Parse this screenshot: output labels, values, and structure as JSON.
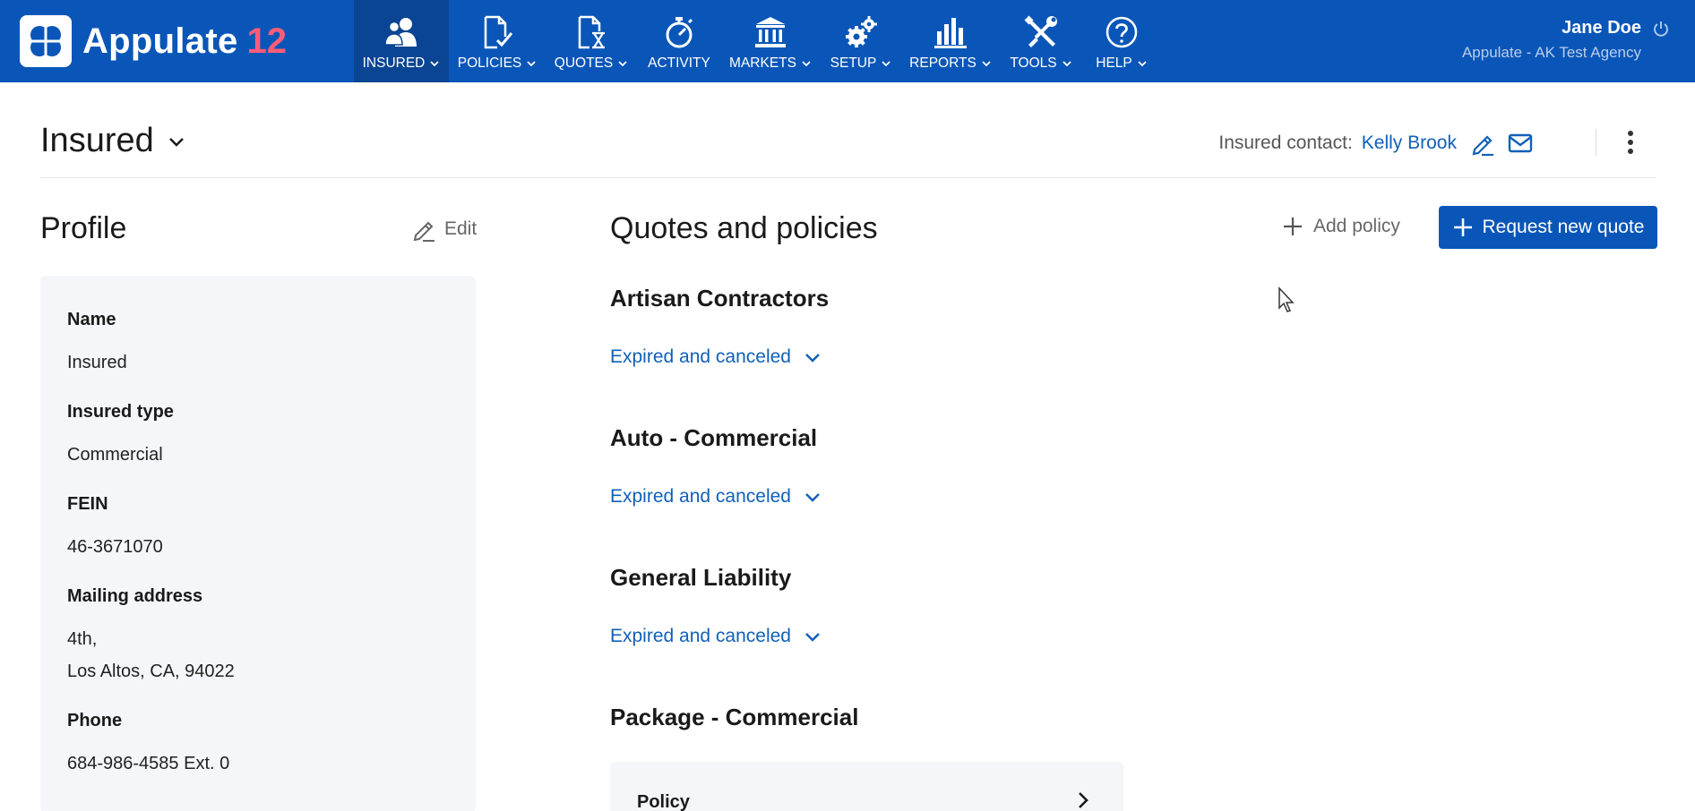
{
  "app": {
    "name": "Appulate",
    "version": "12"
  },
  "nav": {
    "items": [
      {
        "label": "INSURED",
        "icon": "insured-users-icon",
        "has_dropdown": true,
        "active": true
      },
      {
        "label": "POLICIES",
        "icon": "policies-document-check-icon",
        "has_dropdown": true,
        "active": false
      },
      {
        "label": "QUOTES",
        "icon": "quotes-hourglass-document-icon",
        "has_dropdown": true,
        "active": false
      },
      {
        "label": "ACTIVITY",
        "icon": "activity-stopwatch-icon",
        "has_dropdown": false,
        "active": false
      },
      {
        "label": "MARKETS",
        "icon": "markets-bank-icon",
        "has_dropdown": true,
        "active": false
      },
      {
        "label": "SETUP",
        "icon": "setup-gears-icon",
        "has_dropdown": true,
        "active": false
      },
      {
        "label": "REPORTS",
        "icon": "reports-bar-chart-icon",
        "has_dropdown": true,
        "active": false
      },
      {
        "label": "TOOLS",
        "icon": "tools-wrench-screwdriver-icon",
        "has_dropdown": true,
        "active": false
      },
      {
        "label": "HELP",
        "icon": "help-question-icon",
        "has_dropdown": true,
        "active": false
      }
    ]
  },
  "user": {
    "name": "Jane Doe",
    "organization": "Appulate - AK Test Agency"
  },
  "header": {
    "title": "Insured",
    "contact_label": "Insured contact:",
    "contact_name": "Kelly Brook"
  },
  "profile": {
    "title": "Profile",
    "edit_label": "Edit",
    "fields": [
      {
        "label": "Name",
        "value": "Insured"
      },
      {
        "label": "Insured type",
        "value": "Commercial"
      },
      {
        "label": "FEIN",
        "value": "46-3671070"
      },
      {
        "label": "Mailing address",
        "value_line1": "4th,",
        "value_line2": "Los Altos, CA, 94022"
      },
      {
        "label": "Phone",
        "value": "684-986-4585 Ext. 0"
      }
    ]
  },
  "quotes": {
    "title": "Quotes and policies",
    "add_policy_label": "Add policy",
    "request_quote_label": "Request new quote",
    "sections": [
      {
        "title": "Artisan Contractors",
        "link": "Expired and canceled"
      },
      {
        "title": "Auto - Commercial",
        "link": "Expired and canceled"
      },
      {
        "title": "General Liability",
        "link": "Expired and canceled"
      },
      {
        "title": "Package - Commercial",
        "card_label": "Policy"
      }
    ]
  },
  "colors": {
    "brand_blue": "#0a56b8",
    "nav_active": "#0a4593",
    "link_blue": "#1060b8",
    "version_pink": "#ff5c7a",
    "card_bg": "#f5f6fa"
  }
}
